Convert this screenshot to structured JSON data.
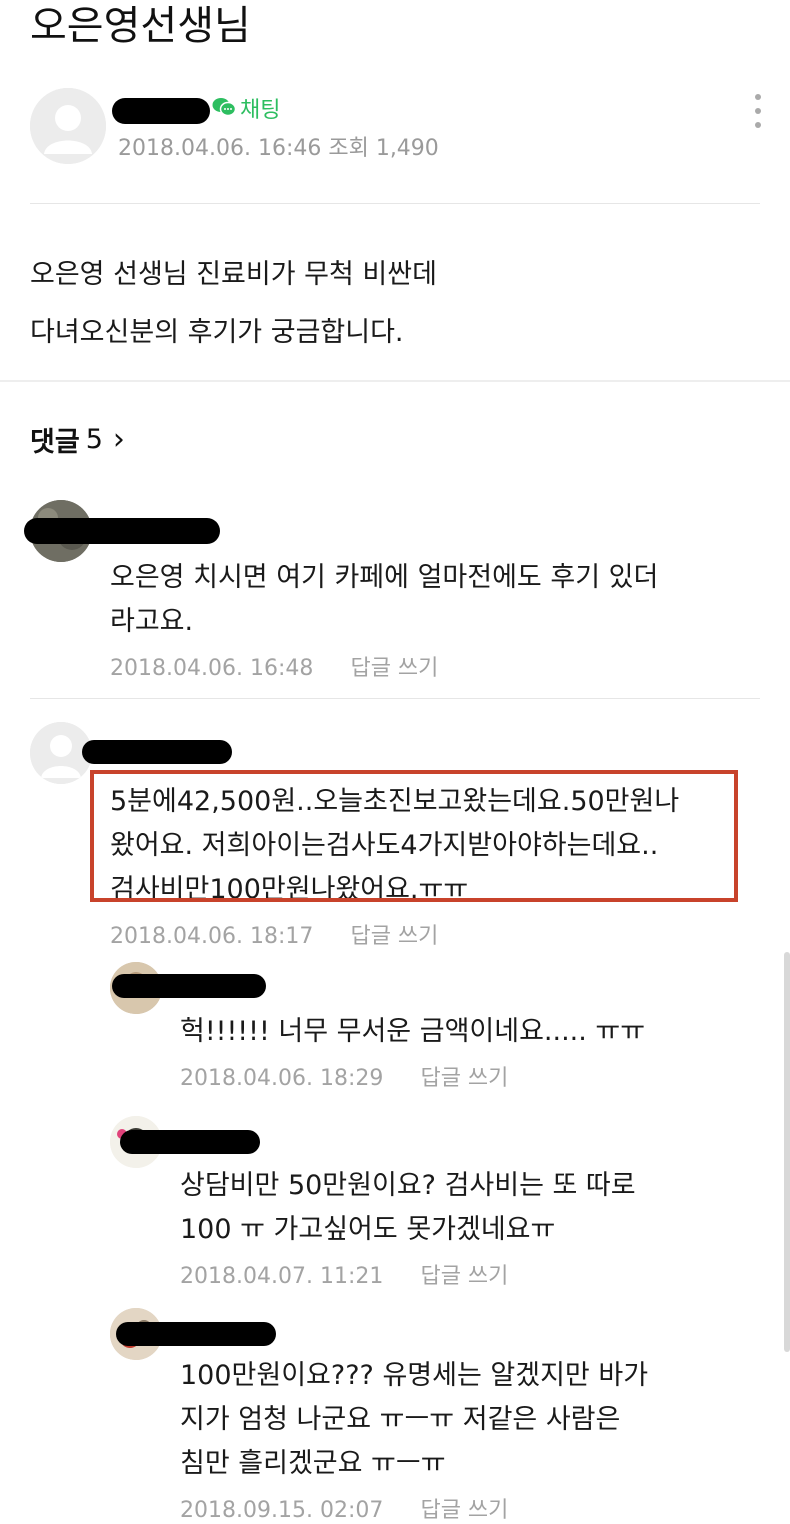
{
  "post": {
    "title": "오은영선생님",
    "chat_label": "채팅",
    "meta": "2018.04.06. 16:46  조회 1,490",
    "body_lines": [
      "오은영 선생님 진료비가 무척 비싼데",
      "다녀오신분의 후기가 궁금합니다."
    ]
  },
  "comments_header": {
    "label": "댓글",
    "count": "5",
    "chevron": "›"
  },
  "reply_label": "답글 쓰기",
  "comments": [
    {
      "lines": [
        "오은영 치시면 여기 카페에 얼마전에도 후기 있더",
        "라고요."
      ],
      "date": "2018.04.06. 16:48"
    },
    {
      "lines": [
        "5분에42,500원..오늘초진보고왔는데요.50만원나",
        "왔어요. 저희아이는검사도4가지받아야하는데요..",
        "검사비만100만원나왔어요.ㅠㅠ"
      ],
      "date": "2018.04.06. 18:17"
    },
    {
      "lines": [
        "헉!!!!!! 너무 무서운 금액이네요..... ㅠㅠ"
      ],
      "date": "2018.04.06. 18:29"
    },
    {
      "lines": [
        "상담비만 50만원이요? 검사비는 또 따로",
        "100 ㅠ 가고싶어도 못가겠네요ㅠ"
      ],
      "date": "2018.04.07. 11:21"
    },
    {
      "lines": [
        "100만원이요??? 유명세는 알겠지만 바가",
        "지가 엄청 나군요 ㅠㅡㅠ 저같은 사람은",
        "침만 흘리겠군요 ㅠㅡㅠ"
      ],
      "date": "2018.09.15. 02:07"
    }
  ],
  "colors": {
    "chat_green": "#2dbe60",
    "highlight_red": "#c8432b",
    "meta_gray": "#9a9a9a"
  },
  "icons": [
    "default-avatar-icon",
    "chat-bubble-icon",
    "more-options-icon",
    "chevron-right-icon"
  ]
}
